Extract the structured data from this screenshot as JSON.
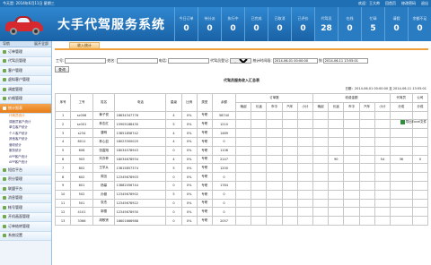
{
  "topbar": {
    "date": "今天是: 2014年6月11日 星期三",
    "welcome": "欢迎：王大帅",
    "home": "回首页",
    "change_password": "修改密码",
    "logout": "退出"
  },
  "header": {
    "title": "大手代驾服务系统",
    "stats": [
      {
        "label": "今日订单",
        "value": "0"
      },
      {
        "label": "待分派",
        "value": "0"
      },
      {
        "label": "执行中",
        "value": "0"
      },
      {
        "label": "已完成",
        "value": "0"
      },
      {
        "label": "已取消",
        "value": "0"
      },
      {
        "label": "已评价",
        "value": "0"
      },
      {
        "label": "代驾员",
        "value": "28"
      },
      {
        "label": "在线",
        "value": "0"
      },
      {
        "label": "忙碌",
        "value": "5"
      },
      {
        "label": "请假",
        "value": "0"
      },
      {
        "label": "余额不足",
        "value": "0"
      }
    ]
  },
  "sidebar": {
    "nav_label": "导航",
    "collapse_label": "展开全部",
    "menu_top": [
      "订单管理",
      "代驾员管理",
      "客户管理",
      "虚拟客户管理",
      "调度管理",
      "价格管理",
      "统计报表"
    ],
    "active_menu": "统计报表",
    "submenu": [
      "代驾员统计",
      "调度员客户统计",
      "单位客户统计",
      "个人客户统计",
      "其他客户统计",
      "营收统计",
      "服务统计",
      "APP客户统计",
      "APP客户统计"
    ],
    "current_sub": "代驾员统计",
    "menu_bottom": [
      "短信平台",
      "积分管理",
      "联盟平台",
      "消息管理",
      "帐号管理",
      "开机画面管理",
      "订单结转管理",
      "系统设置"
    ]
  },
  "tab": {
    "label": "收入统计"
  },
  "filters": {
    "job_label": "工号:",
    "name_label": "姓名:",
    "phone_label": "电话:",
    "location_label": "代驾员登记:",
    "location_value": "--全部--",
    "time_label": "统计时间段:",
    "start_time": "2014-06-01 00:00:00",
    "to": "到",
    "end_time": "2014-06-11 13:55:01",
    "query_button": "查询",
    "export_label": "导出Excel文件"
  },
  "report": {
    "title": "代驾员服务收入汇总表",
    "date_range": "日期：2014-06-01 00:00:00 至 2014-06-11 13:55:01",
    "headers": {
      "seq": "序号",
      "job": "工号",
      "name": "姓名",
      "phone": "电话",
      "level": "星级",
      "ratio": "比例",
      "type": "类型",
      "balance": "余额",
      "orders": "订单数",
      "income": "收费金额",
      "divided": "代驾员",
      "company": "公司",
      "sub_cols": [
        "晚起",
        "长途",
        "市中",
        "汽车",
        "小计"
      ],
      "income_cols": [
        "晚起",
        "长途",
        "市中",
        "汽车",
        "小计"
      ],
      "share": "分成",
      "share2": "分成"
    },
    "rows": [
      [
        "1",
        "sc006",
        "黄子悦",
        "18634347776",
        "4",
        "0%",
        "专职",
        "58740",
        "",
        "",
        "",
        "",
        "",
        "",
        "",
        "",
        "",
        "",
        "",
        ""
      ],
      [
        "2",
        "sc001",
        "林志红",
        "15905188430",
        "5",
        "0%",
        "专职",
        "1210",
        "",
        "",
        "",
        "",
        "",
        "",
        "",
        "",
        "",
        "",
        "",
        ""
      ],
      [
        "3",
        "s234",
        "唐明",
        "13851858742",
        "4",
        "0%",
        "专职",
        "1489",
        "",
        "",
        "",
        "",
        "",
        "",
        "",
        "",
        "",
        "",
        "",
        ""
      ],
      [
        "4",
        "8011",
        "林心如",
        "18023300025",
        "4",
        "0%",
        "专职",
        "0",
        "",
        "",
        "",
        "",
        "",
        "",
        "",
        "",
        "",
        "",
        "",
        ""
      ],
      [
        "5",
        "606",
        "张嘉翔",
        "18034578943",
        "0",
        "0%",
        "专职",
        "1106",
        "",
        "",
        "",
        "",
        "",
        "",
        "",
        "",
        "",
        "",
        "",
        ""
      ],
      [
        "6",
        "903",
        "刘亦菲",
        "18034678934",
        "4",
        "0%",
        "专职",
        "2147",
        "",
        "",
        "",
        "",
        "",
        "",
        "90",
        "",
        "",
        "54",
        "36",
        "0"
      ],
      [
        "7",
        "802",
        "王学从",
        "13815857374",
        "5",
        "0%",
        "专职",
        "1200",
        "",
        "",
        "",
        "",
        "",
        "",
        "",
        "",
        "",
        "",
        "",
        ""
      ],
      [
        "8",
        "602",
        "周迅",
        "12345678903",
        "0",
        "0%",
        "专职",
        "0",
        "",
        "",
        "",
        "",
        "",
        "",
        "",
        "",
        "",
        "",
        "",
        ""
      ],
      [
        "9",
        "601",
        "杨幂",
        "13882056744",
        "0",
        "0%",
        "专职",
        "1784",
        "",
        "",
        "",
        "",
        "",
        "",
        "",
        "",
        "",
        "",
        "",
        ""
      ],
      [
        "10",
        "502",
        "孙俪",
        "12345678902",
        "5",
        "0%",
        "专职",
        "0",
        "",
        "",
        "",
        "",
        "",
        "",
        "",
        "",
        "",
        "",
        "",
        ""
      ],
      [
        "11",
        "501",
        "张杰",
        "12345678922",
        "0",
        "0%",
        "专职",
        "0",
        "",
        "",
        "",
        "",
        "",
        "",
        "",
        "",
        "",
        "",
        "",
        ""
      ],
      [
        "12",
        "4101",
        "郭雪",
        "12345678930",
        "0",
        "0%",
        "专职",
        "0",
        "",
        "",
        "",
        "",
        "",
        "",
        "",
        "",
        "",
        "",
        "",
        ""
      ],
      [
        "13",
        "3366",
        "胡歌贤",
        "18601666988",
        "0",
        "0%",
        "专职",
        "2057",
        "",
        "",
        "",
        "",
        "",
        "",
        "",
        "",
        "",
        "",
        "",
        ""
      ]
    ]
  },
  "colors": {
    "header_blue": "#1f6fb4",
    "active_orange": "#e77b16",
    "tab_border": "#f0a03a"
  }
}
